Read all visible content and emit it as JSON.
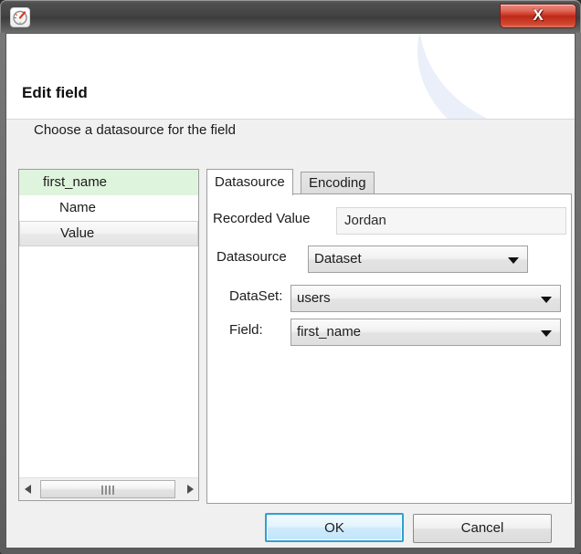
{
  "window": {
    "icon_name": "gauge-icon",
    "close_label": "X"
  },
  "header": {
    "title": "Edit field",
    "subtitle": "Choose a datasource for the field"
  },
  "tree": {
    "items": [
      {
        "label": "first_name",
        "level": 0,
        "state": "green"
      },
      {
        "label": "Name",
        "level": 1,
        "state": "normal"
      },
      {
        "label": "Value",
        "level": 1,
        "state": "hover"
      }
    ]
  },
  "tabs": [
    {
      "label": "Datasource",
      "active": true
    },
    {
      "label": "Encoding",
      "active": false
    }
  ],
  "form": {
    "recorded_value": {
      "label": "Recorded Value",
      "value": "Jordan"
    },
    "datasource": {
      "label": "Datasource",
      "value": "Dataset"
    },
    "dataset": {
      "label": "DataSet:",
      "value": "users"
    },
    "field": {
      "label": "Field:",
      "value": "first_name"
    }
  },
  "buttons": {
    "ok": "OK",
    "cancel": "Cancel"
  },
  "colors": {
    "accent": "#2e9fd6",
    "selection_green": "#dff4dd",
    "close_red": "#c9301d"
  }
}
